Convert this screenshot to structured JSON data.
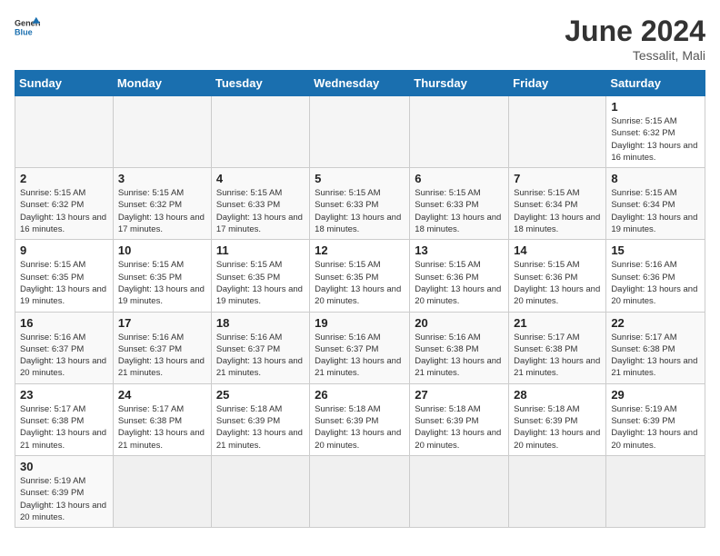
{
  "header": {
    "logo_general": "General",
    "logo_blue": "Blue",
    "month_title": "June 2024",
    "location": "Tessalit, Mali"
  },
  "days_of_week": [
    "Sunday",
    "Monday",
    "Tuesday",
    "Wednesday",
    "Thursday",
    "Friday",
    "Saturday"
  ],
  "weeks": [
    [
      {
        "day": "",
        "info": ""
      },
      {
        "day": "",
        "info": ""
      },
      {
        "day": "",
        "info": ""
      },
      {
        "day": "",
        "info": ""
      },
      {
        "day": "",
        "info": ""
      },
      {
        "day": "",
        "info": ""
      },
      {
        "day": "1",
        "info": "Sunrise: 5:15 AM\nSunset: 6:32 PM\nDaylight: 13 hours and 16 minutes."
      }
    ],
    [
      {
        "day": "2",
        "info": "Sunrise: 5:15 AM\nSunset: 6:32 PM\nDaylight: 13 hours and 16 minutes."
      },
      {
        "day": "3",
        "info": "Sunrise: 5:15 AM\nSunset: 6:32 PM\nDaylight: 13 hours and 17 minutes."
      },
      {
        "day": "4",
        "info": "Sunrise: 5:15 AM\nSunset: 6:33 PM\nDaylight: 13 hours and 17 minutes."
      },
      {
        "day": "5",
        "info": "Sunrise: 5:15 AM\nSunset: 6:33 PM\nDaylight: 13 hours and 18 minutes."
      },
      {
        "day": "6",
        "info": "Sunrise: 5:15 AM\nSunset: 6:33 PM\nDaylight: 13 hours and 18 minutes."
      },
      {
        "day": "7",
        "info": "Sunrise: 5:15 AM\nSunset: 6:34 PM\nDaylight: 13 hours and 18 minutes."
      },
      {
        "day": "8",
        "info": "Sunrise: 5:15 AM\nSunset: 6:34 PM\nDaylight: 13 hours and 19 minutes."
      }
    ],
    [
      {
        "day": "9",
        "info": "Sunrise: 5:15 AM\nSunset: 6:35 PM\nDaylight: 13 hours and 19 minutes."
      },
      {
        "day": "10",
        "info": "Sunrise: 5:15 AM\nSunset: 6:35 PM\nDaylight: 13 hours and 19 minutes."
      },
      {
        "day": "11",
        "info": "Sunrise: 5:15 AM\nSunset: 6:35 PM\nDaylight: 13 hours and 19 minutes."
      },
      {
        "day": "12",
        "info": "Sunrise: 5:15 AM\nSunset: 6:35 PM\nDaylight: 13 hours and 20 minutes."
      },
      {
        "day": "13",
        "info": "Sunrise: 5:15 AM\nSunset: 6:36 PM\nDaylight: 13 hours and 20 minutes."
      },
      {
        "day": "14",
        "info": "Sunrise: 5:15 AM\nSunset: 6:36 PM\nDaylight: 13 hours and 20 minutes."
      },
      {
        "day": "15",
        "info": "Sunrise: 5:16 AM\nSunset: 6:36 PM\nDaylight: 13 hours and 20 minutes."
      }
    ],
    [
      {
        "day": "16",
        "info": "Sunrise: 5:16 AM\nSunset: 6:37 PM\nDaylight: 13 hours and 20 minutes."
      },
      {
        "day": "17",
        "info": "Sunrise: 5:16 AM\nSunset: 6:37 PM\nDaylight: 13 hours and 21 minutes."
      },
      {
        "day": "18",
        "info": "Sunrise: 5:16 AM\nSunset: 6:37 PM\nDaylight: 13 hours and 21 minutes."
      },
      {
        "day": "19",
        "info": "Sunrise: 5:16 AM\nSunset: 6:37 PM\nDaylight: 13 hours and 21 minutes."
      },
      {
        "day": "20",
        "info": "Sunrise: 5:16 AM\nSunset: 6:38 PM\nDaylight: 13 hours and 21 minutes."
      },
      {
        "day": "21",
        "info": "Sunrise: 5:17 AM\nSunset: 6:38 PM\nDaylight: 13 hours and 21 minutes."
      },
      {
        "day": "22",
        "info": "Sunrise: 5:17 AM\nSunset: 6:38 PM\nDaylight: 13 hours and 21 minutes."
      }
    ],
    [
      {
        "day": "23",
        "info": "Sunrise: 5:17 AM\nSunset: 6:38 PM\nDaylight: 13 hours and 21 minutes."
      },
      {
        "day": "24",
        "info": "Sunrise: 5:17 AM\nSunset: 6:38 PM\nDaylight: 13 hours and 21 minutes."
      },
      {
        "day": "25",
        "info": "Sunrise: 5:18 AM\nSunset: 6:39 PM\nDaylight: 13 hours and 21 minutes."
      },
      {
        "day": "26",
        "info": "Sunrise: 5:18 AM\nSunset: 6:39 PM\nDaylight: 13 hours and 20 minutes."
      },
      {
        "day": "27",
        "info": "Sunrise: 5:18 AM\nSunset: 6:39 PM\nDaylight: 13 hours and 20 minutes."
      },
      {
        "day": "28",
        "info": "Sunrise: 5:18 AM\nSunset: 6:39 PM\nDaylight: 13 hours and 20 minutes."
      },
      {
        "day": "29",
        "info": "Sunrise: 5:19 AM\nSunset: 6:39 PM\nDaylight: 13 hours and 20 minutes."
      }
    ],
    [
      {
        "day": "30",
        "info": "Sunrise: 5:19 AM\nSunset: 6:39 PM\nDaylight: 13 hours and 20 minutes."
      },
      {
        "day": "",
        "info": ""
      },
      {
        "day": "",
        "info": ""
      },
      {
        "day": "",
        "info": ""
      },
      {
        "day": "",
        "info": ""
      },
      {
        "day": "",
        "info": ""
      },
      {
        "day": "",
        "info": ""
      }
    ]
  ]
}
